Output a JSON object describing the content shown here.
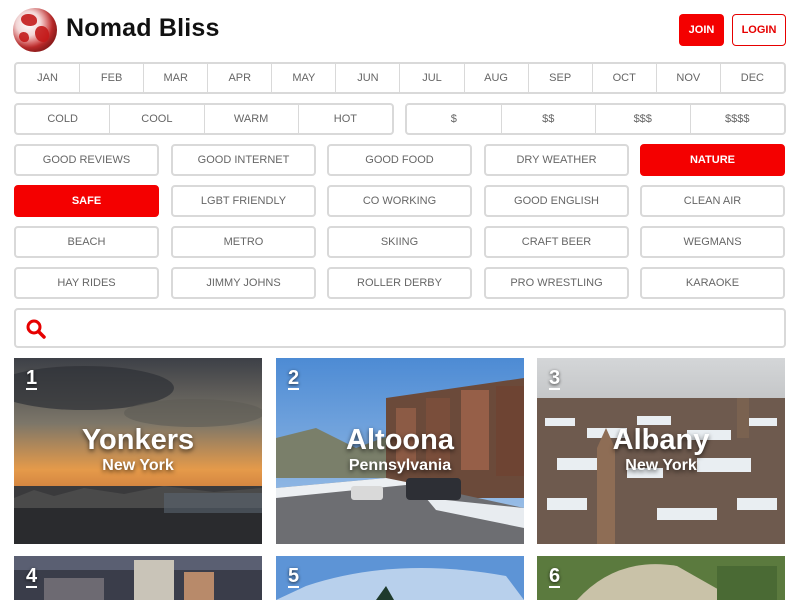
{
  "brand": {
    "name": "Nomad Bliss"
  },
  "auth": {
    "join_label": "JOIN",
    "login_label": "LOGIN"
  },
  "months": [
    "JAN",
    "FEB",
    "MAR",
    "APR",
    "MAY",
    "JUN",
    "JUL",
    "AUG",
    "SEP",
    "OCT",
    "NOV",
    "DEC"
  ],
  "temperatures": [
    "COLD",
    "COOL",
    "WARM",
    "HOT"
  ],
  "costs": [
    "$",
    "$$",
    "$$$",
    "$$$$"
  ],
  "tags": [
    {
      "label": "GOOD REVIEWS",
      "active": false
    },
    {
      "label": "GOOD INTERNET",
      "active": false
    },
    {
      "label": "GOOD FOOD",
      "active": false
    },
    {
      "label": "DRY WEATHER",
      "active": false
    },
    {
      "label": "NATURE",
      "active": true
    },
    {
      "label": "SAFE",
      "active": true
    },
    {
      "label": "LGBT FRIENDLY",
      "active": false
    },
    {
      "label": "CO WORKING",
      "active": false
    },
    {
      "label": "GOOD ENGLISH",
      "active": false
    },
    {
      "label": "CLEAN AIR",
      "active": false
    },
    {
      "label": "BEACH",
      "active": false
    },
    {
      "label": "METRO",
      "active": false
    },
    {
      "label": "SKIING",
      "active": false
    },
    {
      "label": "CRAFT BEER",
      "active": false
    },
    {
      "label": "WEGMANS",
      "active": false
    },
    {
      "label": "HAY RIDES",
      "active": false
    },
    {
      "label": "JIMMY JOHNS",
      "active": false
    },
    {
      "label": "ROLLER DERBY",
      "active": false
    },
    {
      "label": "PRO WRESTLING",
      "active": false
    },
    {
      "label": "KARAOKE",
      "active": false
    }
  ],
  "search": {
    "placeholder": "",
    "icon": "search-icon"
  },
  "cities": [
    {
      "rank": "1",
      "city": "Yonkers",
      "region": "New York"
    },
    {
      "rank": "2",
      "city": "Altoona",
      "region": "Pennsylvania"
    },
    {
      "rank": "3",
      "city": "Albany",
      "region": "New York"
    },
    {
      "rank": "4",
      "city": "",
      "region": ""
    },
    {
      "rank": "5",
      "city": "",
      "region": ""
    },
    {
      "rank": "6",
      "city": "",
      "region": ""
    }
  ],
  "colors": {
    "accent": "#f40000",
    "border": "#d9d9d9",
    "text": "#666666"
  }
}
